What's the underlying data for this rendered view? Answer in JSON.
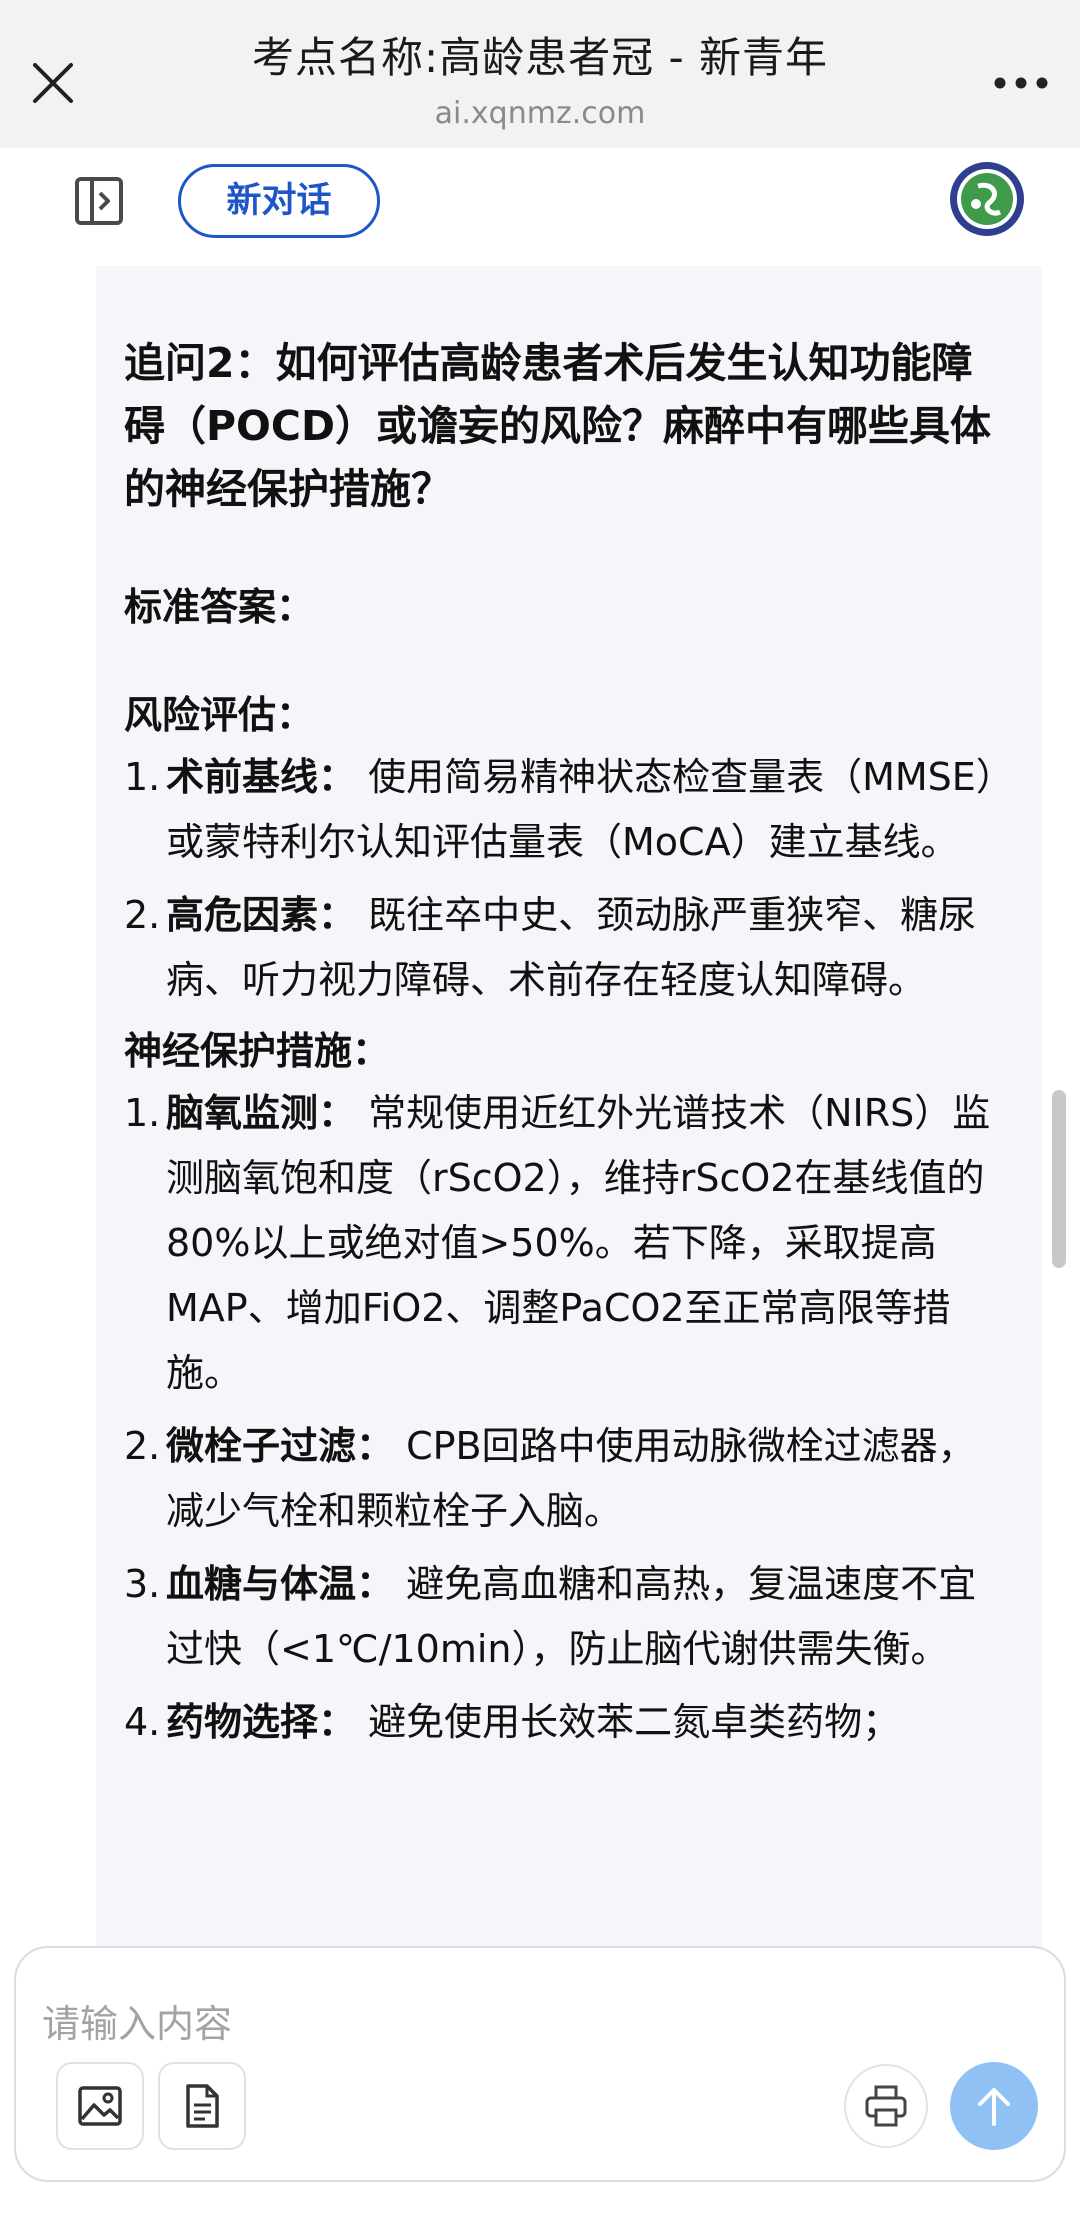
{
  "browser": {
    "title": "考点名称:高龄患者冠 - 新青年",
    "url": "ai.xqnmz.com",
    "close_icon": "close-icon",
    "more_icon": "more-icon"
  },
  "header": {
    "sidebar_icon": "sidebar-toggle-icon",
    "new_chat_label": "新对话",
    "logo_icon": "society-logo"
  },
  "message": {
    "question": "追问2：如何评估高龄患者术后发生认知功能障碍（POCD）或谵妄的风险？麻醉中有哪些具体的神经保护措施？",
    "answer_label": "标准答案：",
    "risk_section": {
      "heading": "风险评估：",
      "items": [
        {
          "num": "1.",
          "term": "术前基线：",
          "text": "使用简易精神状态检查量表（MMSE）或蒙特利尔认知评估量表（MoCA）建立基线。"
        },
        {
          "num": "2.",
          "term": "高危因素：",
          "text": "既往卒中史、颈动脉严重狭窄、糖尿病、听力视力障碍、术前存在轻度认知障碍。"
        }
      ]
    },
    "protect_section": {
      "heading": "神经保护措施：",
      "items": [
        {
          "num": "1.",
          "term": "脑氧监测：",
          "text": "常规使用近红外光谱技术（NIRS）监测脑氧饱和度（rScO2），维持rScO2在基线值的80%以上或绝对值>50%。若下降，采取提高MAP、增加FiO2、调整PaCO2至正常高限等措施。"
        },
        {
          "num": "2.",
          "term": "微栓子过滤：",
          "text": "CPB回路中使用动脉微栓过滤器，减少气栓和颗粒栓子入脑。"
        },
        {
          "num": "3.",
          "term": "血糖与体温：",
          "text": "避免高血糖和高热，复温速度不宜过快（<1℃/10min），防止脑代谢供需失衡。"
        },
        {
          "num": "4.",
          "term": "药物选择：",
          "text": "避免使用长效苯二氮卓类药物；"
        }
      ]
    }
  },
  "composer": {
    "placeholder": "请输入内容",
    "image_icon": "image-icon",
    "file_icon": "document-icon",
    "print_icon": "printer-icon",
    "send_icon": "arrow-up-icon"
  },
  "colors": {
    "accent": "#1e56c7",
    "send_button": "#8fc1f5",
    "card_background": "#f4f6f9",
    "topbar_background": "#f2f2f2"
  }
}
